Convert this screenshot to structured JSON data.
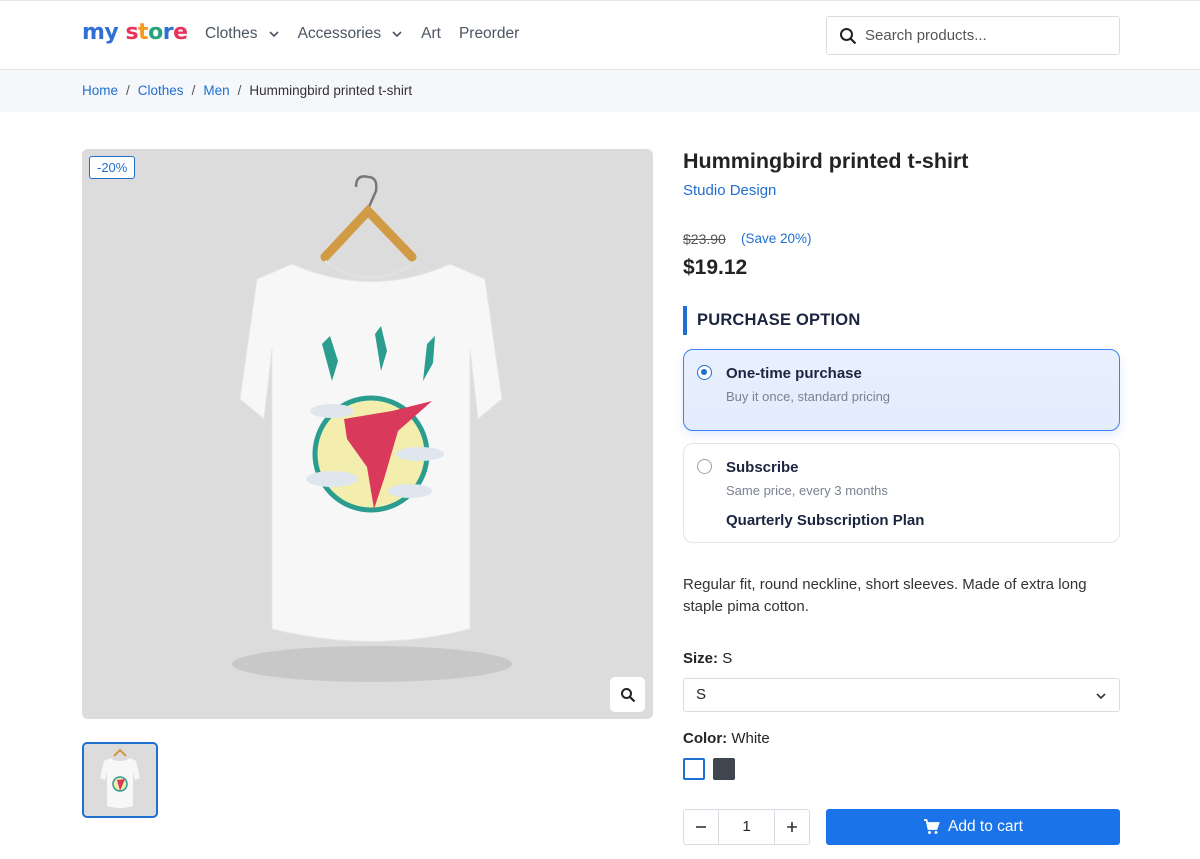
{
  "header": {
    "logo_my": "my",
    "logo_store": [
      "s",
      "t",
      "o",
      "r",
      "e"
    ],
    "nav": [
      {
        "label": "Clothes",
        "dropdown": true
      },
      {
        "label": "Accessories",
        "dropdown": true
      },
      {
        "label": "Art",
        "dropdown": false
      },
      {
        "label": "Preorder",
        "dropdown": false
      }
    ],
    "search_placeholder": "Search products..."
  },
  "breadcrumb": {
    "items": [
      "Home",
      "Clothes",
      "Men"
    ],
    "current": "Hummingbird printed t-shirt",
    "separator": "/"
  },
  "gallery": {
    "discount_badge": "-20%",
    "zoom_icon": "magnifier-icon"
  },
  "product": {
    "title": "Hummingbird printed t-shirt",
    "brand": "Studio Design",
    "old_price": "$23.90",
    "save_text": "(Save 20%)",
    "price": "$19.12",
    "purchase_heading": "PURCHASE OPTION",
    "options": [
      {
        "name": "One-time purchase",
        "sub": "Buy it once, standard pricing",
        "selected": true
      },
      {
        "name": "Subscribe",
        "sub": "Same price, every 3 months",
        "plan": "Quarterly Subscription Plan",
        "selected": false
      }
    ],
    "description": "Regular fit, round neckline, short sleeves. Made of extra long staple pima cotton.",
    "size_label": "Size:",
    "size_value": "S",
    "size_selected": "S",
    "color_label": "Color:",
    "color_value": "White",
    "colors": [
      "#ffffff",
      "#3f464f"
    ],
    "quantity": "1",
    "add_to_cart": "Add to cart",
    "accent": "#1a73e8"
  }
}
